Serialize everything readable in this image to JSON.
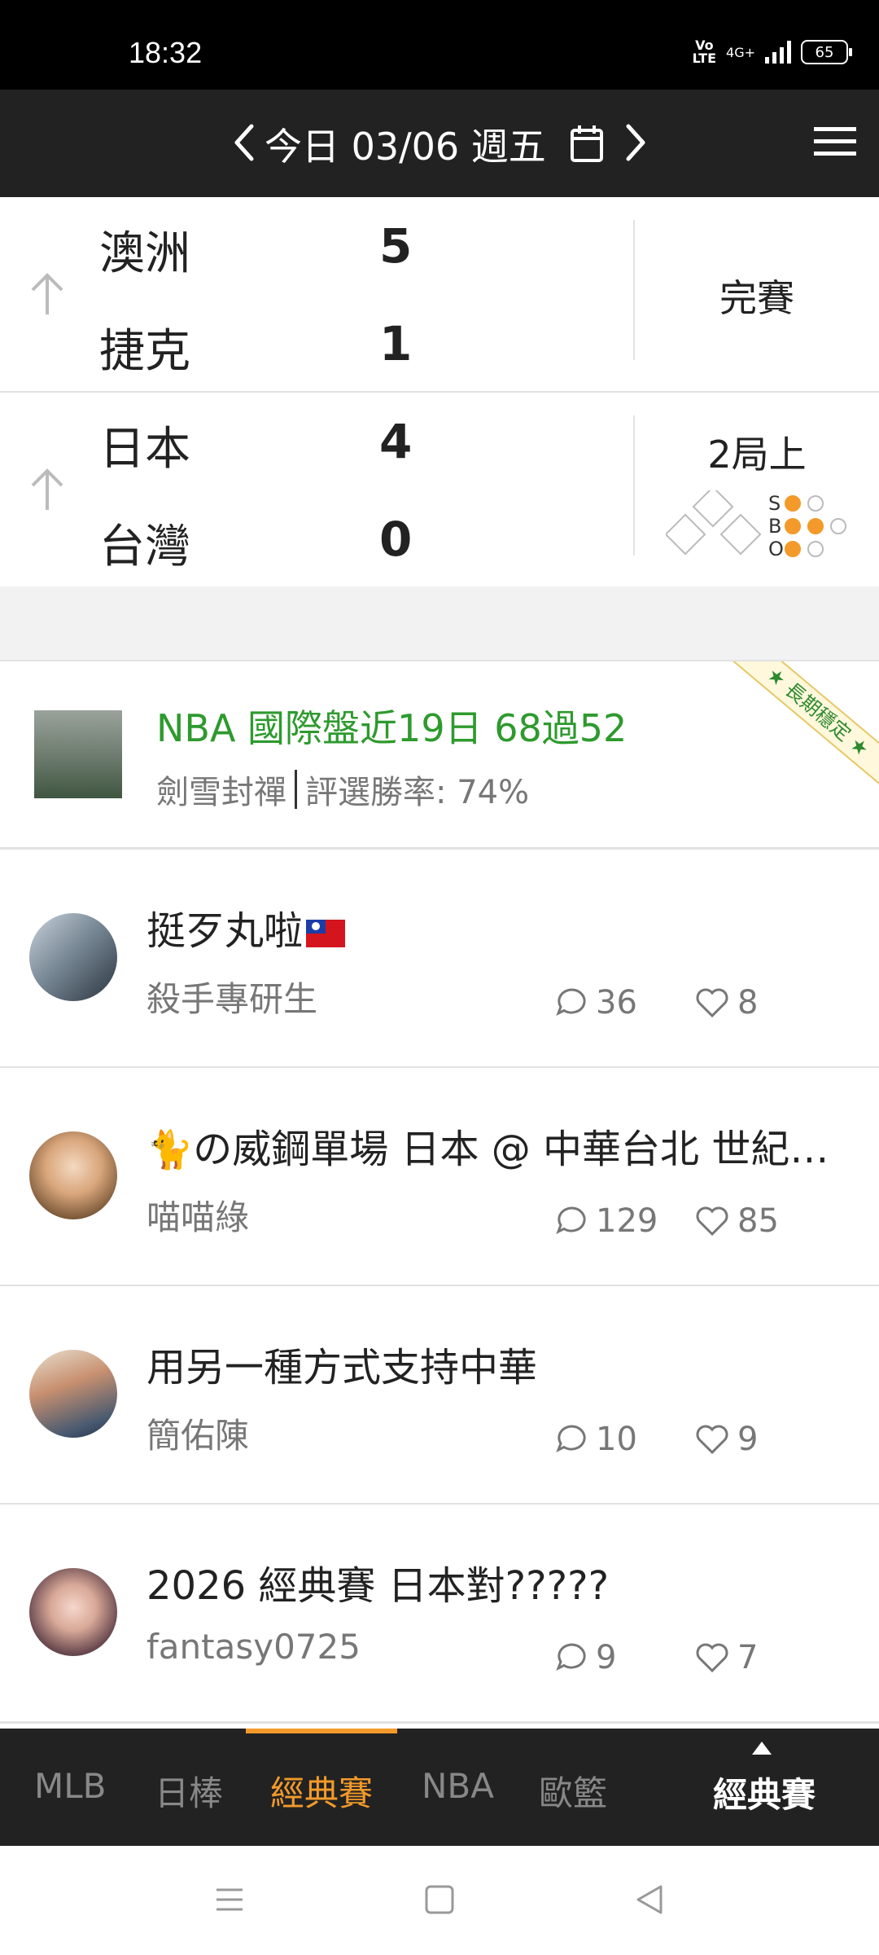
{
  "status_bar": {
    "time": "18:32",
    "volte": "Vo\nLTE",
    "network": "4G+",
    "battery": "65"
  },
  "header": {
    "date": "今日 03/06 週五"
  },
  "games": [
    {
      "team1": "澳洲",
      "score1": "5",
      "team2": "捷克",
      "score2": "1",
      "status": "完賽"
    },
    {
      "team1": "日本",
      "score1": "4",
      "team2": "台灣",
      "score2": "0",
      "status": "2局上",
      "count": {
        "S": "S",
        "B": "B",
        "O": "O",
        "strikes": 1,
        "balls": 2,
        "outs": 1
      }
    }
  ],
  "ad": {
    "title": "NBA 國際盤近19日 68過52",
    "author": "劍雪封禪",
    "rate": "評選勝率: 74%",
    "ribbon": "★ 長期穩定 ★"
  },
  "posts": [
    {
      "title": "挺歹丸啦",
      "author": "殺手專研生",
      "comments": "36",
      "likes": "8"
    },
    {
      "title": "の威鋼單場 日本 @ 中華台北 世紀大戰",
      "author": "喵喵綠",
      "comments": "129",
      "likes": "85"
    },
    {
      "title": "用另一種方式支持中華",
      "author": "簡佑陳",
      "comments": "10",
      "likes": "9"
    },
    {
      "title": "2026 經典賽 日本對?????",
      "author": "fantasy0725",
      "comments": "9",
      "likes": "7"
    }
  ],
  "tabs": [
    "MLB",
    "日棒",
    "經典賽",
    "NBA",
    "歐籃"
  ],
  "current_section": "經典賽",
  "colors": {
    "accent": "#f39a2a",
    "ad_green": "#2e9a2e",
    "header_bg": "#222222"
  }
}
